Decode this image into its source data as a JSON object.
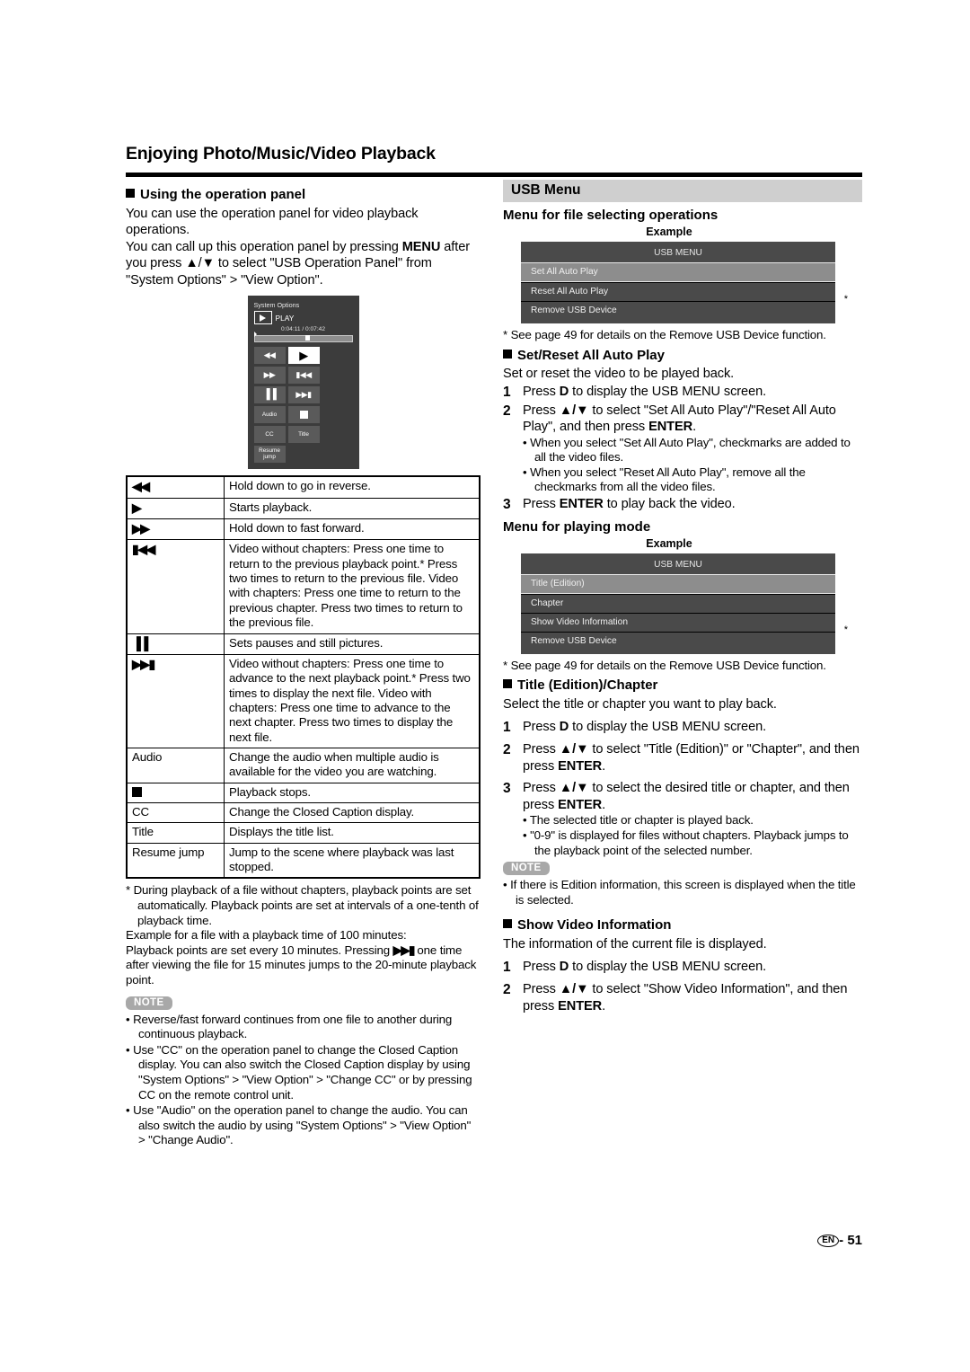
{
  "header": {
    "chapter_title": "Enjoying Photo/Music/Video Playback"
  },
  "left": {
    "section_title": "Using the operation panel",
    "intro_1": "You can use the operation panel for video playback operations.",
    "intro_2": "You can call up this operation panel by pressing ",
    "intro_menu_bold": "MENU",
    "intro_3": " after you press ▲/▼ to select \"USB Operation Panel\" from \"System Options\" > \"View Option\".",
    "op_panel": {
      "system_options_label": "System Options",
      "play_label": "PLAY",
      "time": "0:04:11 / 0:07:42",
      "buttons": [
        {
          "name": "rewind",
          "glyph": "◀◀"
        },
        {
          "name": "play",
          "glyph": "▶"
        },
        {
          "name": "fast-forward",
          "glyph": "▶▶"
        },
        {
          "name": "previous",
          "glyph": "▮◀◀"
        },
        {
          "name": "pause",
          "glyph": "▐▐"
        },
        {
          "name": "next",
          "glyph": "▶▶▮"
        },
        {
          "name": "audio",
          "glyph": "Audio"
        },
        {
          "name": "stop",
          "glyph": "■"
        },
        {
          "name": "cc",
          "glyph": "CC"
        },
        {
          "name": "title",
          "glyph": "Title"
        },
        {
          "name": "resume-jump",
          "glyph": "Resume jump"
        }
      ]
    },
    "table_rows": [
      {
        "icon": "◀◀",
        "icon_type": "glyph",
        "desc": "Hold down to go in reverse."
      },
      {
        "icon": "▶",
        "icon_type": "glyph",
        "desc": "Starts playback."
      },
      {
        "icon": "▶▶",
        "icon_type": "glyph",
        "desc": "Hold down to fast forward."
      },
      {
        "icon": "▮◀◀",
        "icon_type": "glyph",
        "desc": "Video without chapters: Press one time to return to the previous playback point.* Press two times to return to the previous file. Video with chapters: Press one time to return to the previous chapter. Press two times to return to the previous file."
      },
      {
        "icon": "▐▐",
        "icon_type": "glyph",
        "desc": "Sets pauses and still pictures."
      },
      {
        "icon": "▶▶▮",
        "icon_type": "glyph",
        "desc": "Video without chapters: Press one time to advance to the next playback point.* Press two times to display the next file. Video with chapters: Press one time to advance to the next chapter. Press two times to display the next file."
      },
      {
        "icon": "Audio",
        "icon_type": "text",
        "desc": "Change the audio when multiple audio is available for the video you are watching."
      },
      {
        "icon": "stop-square",
        "icon_type": "square",
        "desc": "Playback stops."
      },
      {
        "icon": "CC",
        "icon_type": "text",
        "desc": "Change the Closed Caption display."
      },
      {
        "icon": "Title",
        "icon_type": "text",
        "desc": "Displays the title list."
      },
      {
        "icon": "Resume jump",
        "icon_type": "text",
        "desc": "Jump to the scene where playback was last stopped."
      }
    ],
    "footnote_star": "* During playback of a file without chapters, playback points are set automatically. Playback points are set at intervals of a one-tenth of playback time.",
    "footnote_example_1": "Example for a file with a playback time of 100 minutes:",
    "footnote_example_2a": "Playback points are set every 10 minutes. Pressing ",
    "footnote_example_icon": "▶▶▮",
    "footnote_example_2b": " one time after viewing the file for 15 minutes jumps to the 20-minute playback point.",
    "note_badge": "NOTE",
    "notes": [
      "Reverse/fast forward continues from one file to another during continuous playback.",
      "Use \"CC\" on the operation panel to change the Closed Caption display. You can also switch the Closed Caption display by using \"System Options\" > \"View Option\" > \"Change CC\" or by pressing CC on the remote control unit.",
      "Use \"Audio\" on the operation panel to change the audio. You can also switch the audio by using \"System Options\" > \"View Option\" > \"Change Audio\"."
    ]
  },
  "right": {
    "usb_menu_heading": "USB Menu",
    "file_select_heading": "Menu for file selecting operations",
    "example_label_1": "Example",
    "menu_1": {
      "header": "USB MENU",
      "items": [
        {
          "label": "Set All Auto Play",
          "selected": true,
          "star": false
        },
        {
          "label": "Reset All Auto Play",
          "selected": false,
          "star": false
        },
        {
          "label": "Remove USB Device",
          "selected": false,
          "star": true
        }
      ]
    },
    "footnote_1": "* See page 49 for details on the Remove USB Device function.",
    "setreset_heading": "Set/Reset All Auto Play",
    "setreset_intro": "Set or reset the video to be played back.",
    "setreset_steps": [
      {
        "n": "1",
        "text": "Press D to display the USB MENU screen."
      },
      {
        "n": "2",
        "text": "Press ▲/▼ to select \"Set All Auto Play\"/\"Reset All Auto Play\", and then press ENTER."
      },
      {
        "n": "3",
        "text": "Press ENTER to play back the video."
      }
    ],
    "setreset_bullets": [
      "When you select \"Set All Auto Play\", checkmarks are added to all the video files.",
      "When you select \"Reset All Auto Play\", remove all the checkmarks from all the video files."
    ],
    "playmode_heading": "Menu for playing mode",
    "example_label_2": "Example",
    "menu_2": {
      "header": "USB MENU",
      "items": [
        {
          "label": "Title (Edition)",
          "selected": true,
          "star": false
        },
        {
          "label": "Chapter",
          "selected": false,
          "star": false
        },
        {
          "label": "Show Video Information",
          "selected": false,
          "star": false
        },
        {
          "label": "Remove USB Device",
          "selected": false,
          "star": true
        }
      ]
    },
    "footnote_2": "* See page 49 for details on the Remove USB Device function.",
    "title_chapter_heading": "Title (Edition)/Chapter",
    "title_chapter_intro": "Select the title or chapter you want to play back.",
    "title_chapter_steps": [
      {
        "n": "1",
        "text": "Press D to display the USB MENU screen."
      },
      {
        "n": "2",
        "text": "Press ▲/▼ to select \"Title (Edition)\" or \"Chapter\", and then press ENTER."
      },
      {
        "n": "3",
        "text": "Press ▲/▼ to select the desired title or chapter, and then press ENTER."
      }
    ],
    "title_chapter_bullets": [
      "The selected title or chapter is played back.",
      "\"0-9\" is displayed for files without chapters. Playback jumps to the playback point of the selected number."
    ],
    "note_badge_2": "NOTE",
    "note_2": "If there is Edition information, this screen is displayed when the title is selected.",
    "show_video_heading": "Show Video Information",
    "show_video_intro": "The information of the current file is displayed.",
    "show_video_steps": [
      {
        "n": "1",
        "text": "Press D to display the USB MENU screen."
      },
      {
        "n": "2",
        "text": "Press ▲/▼ to select \"Show Video Information\", and then press ENTER."
      }
    ]
  },
  "footer": {
    "lang_code": "EN",
    "separator": "-",
    "page_number": "51"
  }
}
